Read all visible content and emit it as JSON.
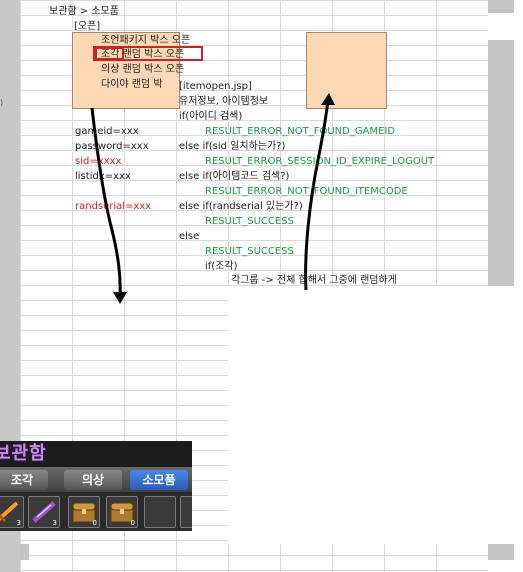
{
  "breadcrumb": "보관함 > 소모품",
  "section_label": "[오픈]",
  "open_items": [
    "조언패키지 박스 오픈",
    "조각 랜덤 박스 오픈",
    "의상 랜덤 박스 오픈",
    "다이야 랜덤 박"
  ],
  "jsp_name": "[itemopen.jsp]",
  "user_info": "유저정보, 아이템정보",
  "params": {
    "gameid": "gameid=xxx",
    "password": "password=xxx",
    "sid": "sid=xxxx",
    "listidx": "listidx=xxx",
    "randserial": "randserial=xxx"
  },
  "logic": [
    "if(아이디 검색)",
    "RESULT_ERROR_NOT_FOUND_GAMEID",
    "else if(sid 일치하는가?)",
    "RESULT_ERROR_SESSION_ID_EXPIRE_LOGOUT",
    "else if(아이템코드 검색?)",
    "RESULT_ERROR_NOT_FOUND_ITEMCODE",
    "else if(randserial 있는가?)",
    "RESULT_SUCCESS",
    "else",
    "RESULT_SUCCESS",
    "if(조각)",
    "각그룹 -> 전체 합해서 그중에 랜덤하게"
  ],
  "left_edge_char": ")",
  "game": {
    "title": "보관함",
    "tabs": [
      "조각",
      "의상",
      "소모품"
    ],
    "slot_counts": [
      "3",
      "3",
      "0",
      "0",
      ""
    ]
  },
  "colors": {
    "orange_box": "#fdd8b4",
    "highlight_red": "#d32020",
    "result_green": "#1a9e3a",
    "active_tab": "#2f6fd0"
  }
}
